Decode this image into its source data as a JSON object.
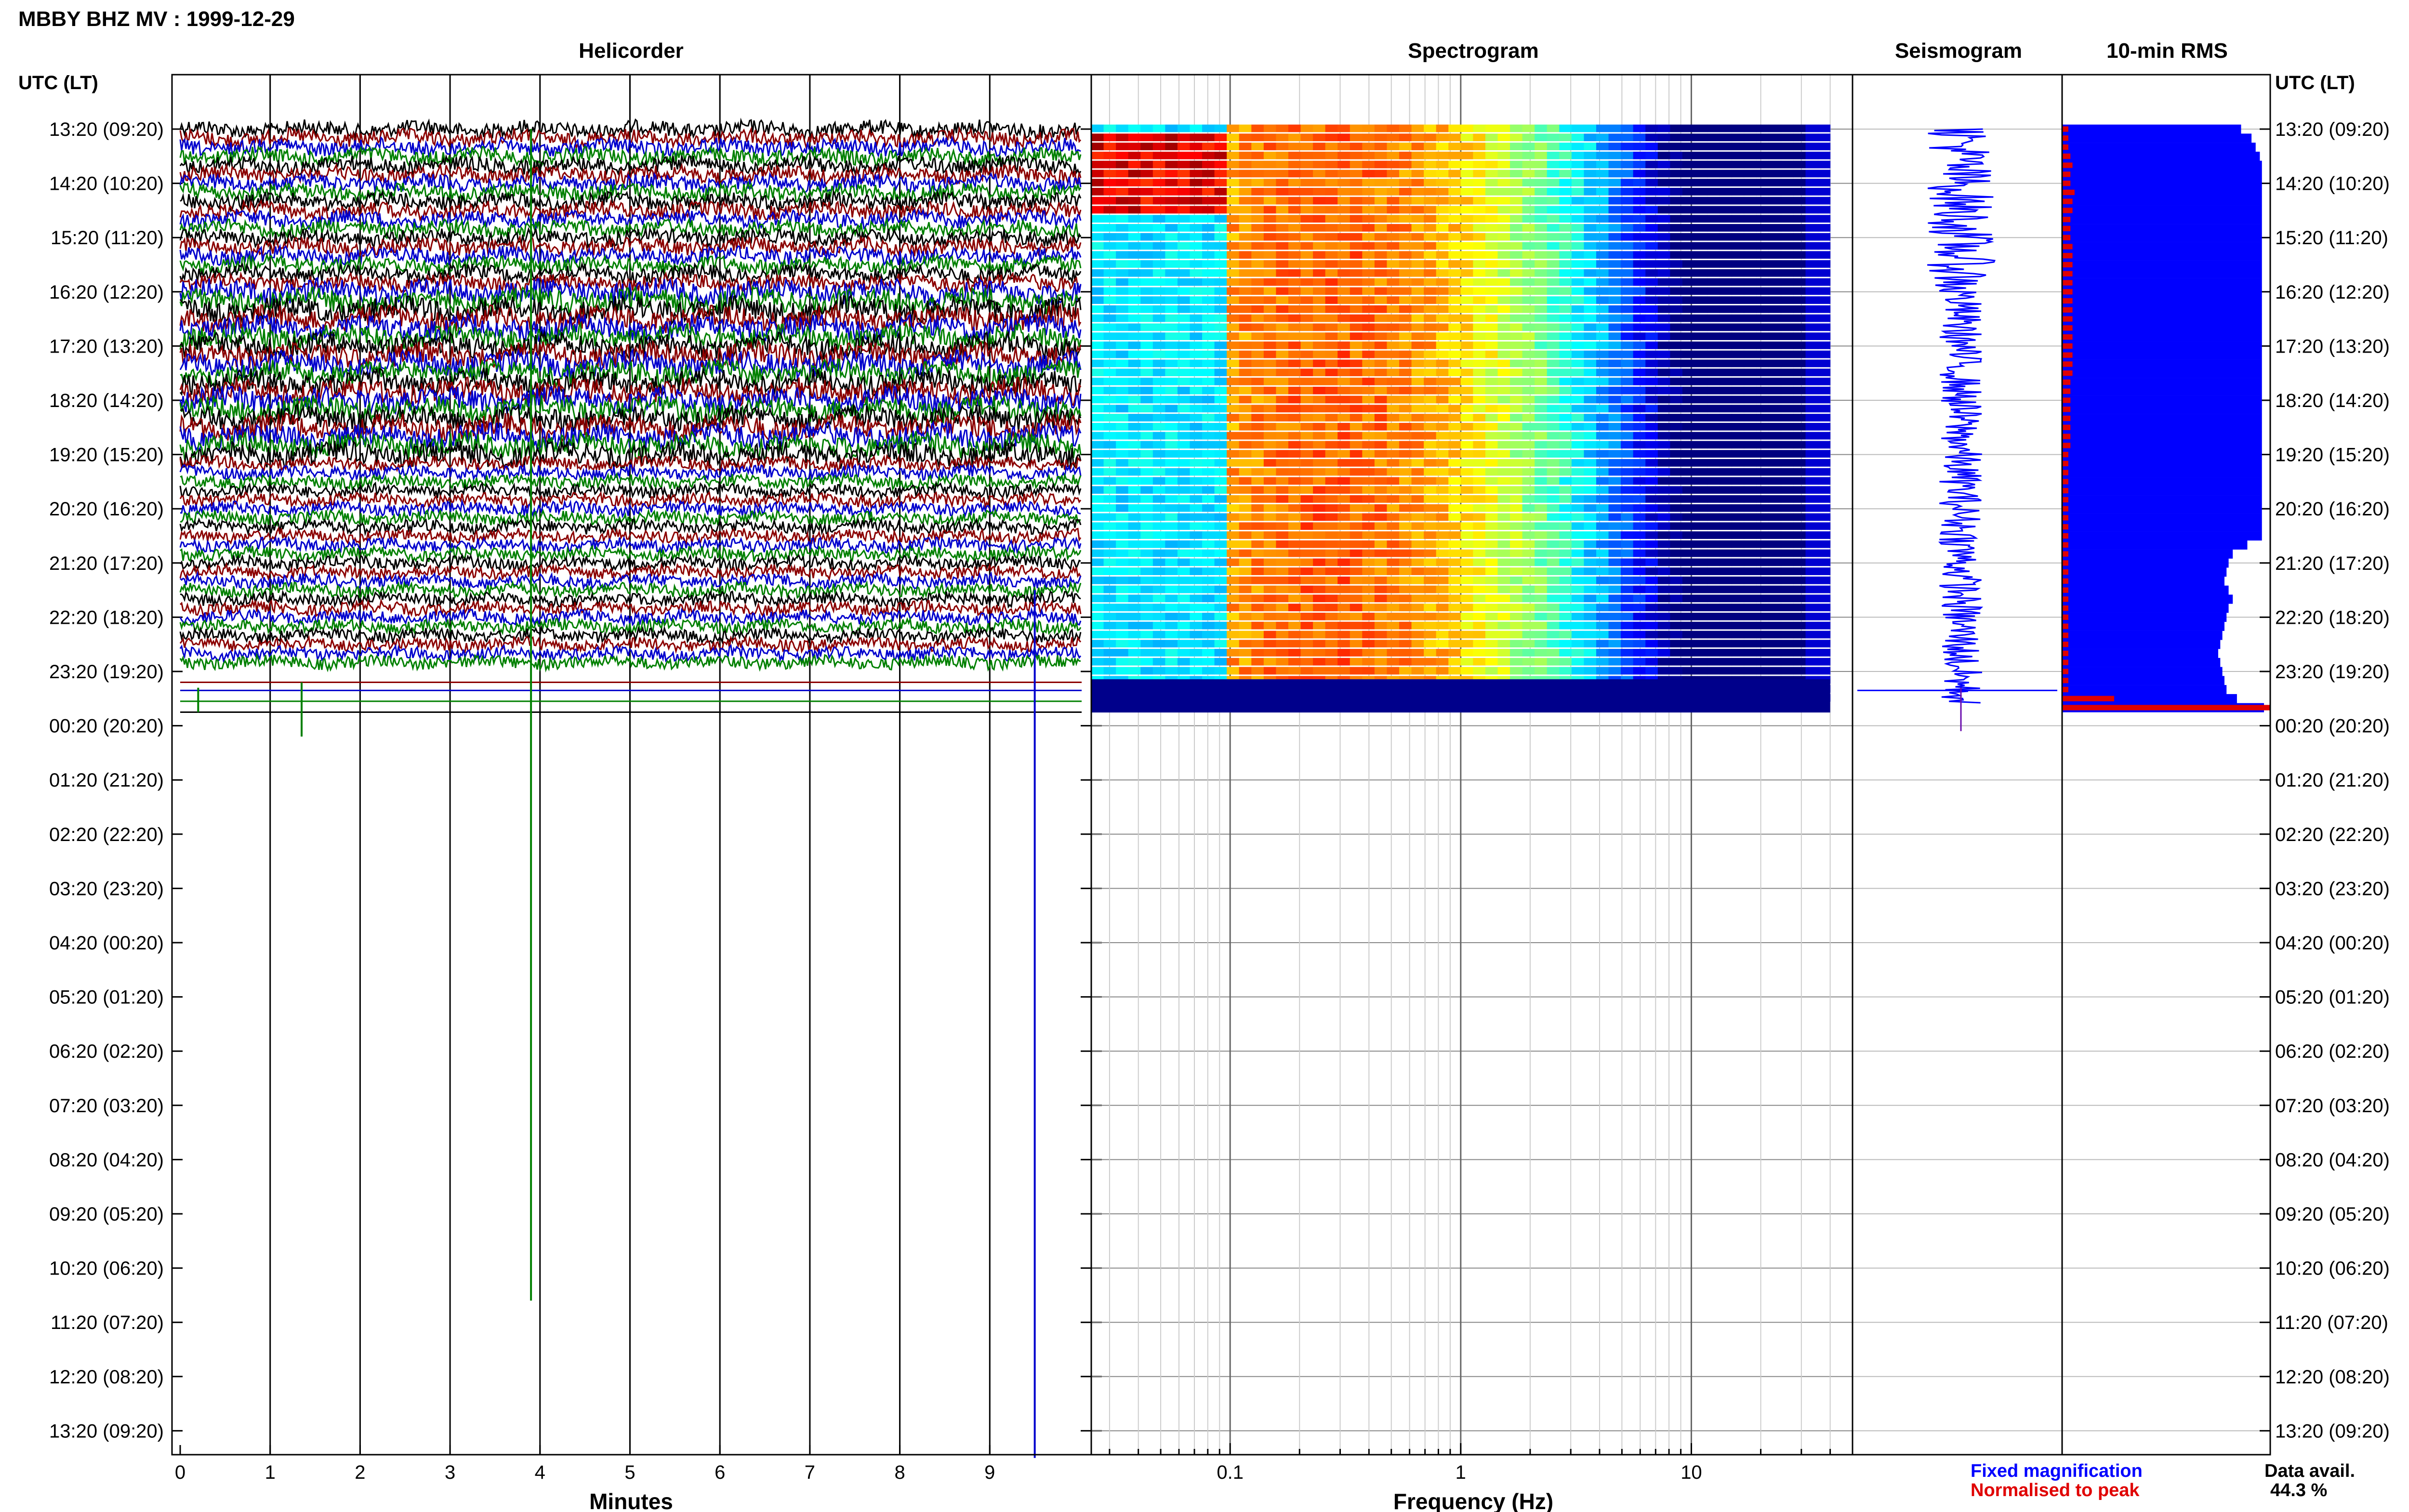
{
  "chart_data": {
    "type": "heatmap",
    "title": "MBBY BHZ MV : 1999-12-29",
    "row_axis_label": "UTC (LT)",
    "row_labels": [
      "13:20 (09:20)",
      "14:20 (10:20)",
      "15:20 (11:20)",
      "16:20 (12:20)",
      "17:20 (13:20)",
      "18:20 (14:20)",
      "19:20 (15:20)",
      "20:20 (16:20)",
      "21:20 (17:20)",
      "22:20 (18:20)",
      "23:20 (19:20)",
      "00:20 (20:20)",
      "01:20 (21:20)",
      "02:20 (22:20)",
      "03:20 (23:20)",
      "04:20 (00:20)",
      "05:20 (01:20)",
      "06:20 (02:20)",
      "07:20 (03:20)",
      "08:20 (04:20)",
      "09:20 (05:20)",
      "10:20 (06:20)",
      "11:20 (07:20)",
      "12:20 (08:20)",
      "13:20 (09:20)"
    ],
    "panels": {
      "helicorder": {
        "title": "Helicorder",
        "xlabel": "Minutes",
        "x_ticks": [
          "0",
          "1",
          "2",
          "3",
          "4",
          "5",
          "6",
          "7",
          "8",
          "9"
        ],
        "xlim": [
          0,
          10
        ],
        "trace_colors": [
          "#000000",
          "#8b0000",
          "#0000cd",
          "#008000"
        ],
        "rows_per_hour": 6,
        "data_rows": 60,
        "spikes": [
          {
            "minute": 3.9,
            "from_hour": 0,
            "to_hour": 21.6,
            "color": "#008000"
          },
          {
            "minute": 9.5,
            "from_hour": 8.5,
            "to_hour": 24.5,
            "color": "#0000cd"
          },
          {
            "minute": 1.35,
            "from_hour": 10.2,
            "to_hour": 11.2,
            "color": "#008000"
          }
        ]
      },
      "spectrogram": {
        "title": "Spectrogram",
        "xlabel": "Frequency (Hz)",
        "x_scale": "log",
        "xlim": [
          0.025,
          50
        ],
        "x_ticks": [
          "0.1",
          "1",
          "10"
        ],
        "colormap": "jet",
        "data_hours": 10.7
      },
      "seismogram": {
        "title": "Seismogram",
        "color": "#0000ff",
        "data_hours": 10.6
      },
      "rms": {
        "title": "10-min RMS",
        "fixed_color": "#0000ff",
        "normalised_color": "#e00000",
        "fixed_magnification": [
          0.86,
          0.91,
          0.93,
          0.95,
          0.96,
          0.96,
          0.96,
          0.96,
          0.96,
          0.96,
          0.96,
          0.96,
          0.96,
          0.96,
          0.96,
          0.96,
          0.96,
          0.96,
          0.96,
          0.96,
          0.96,
          0.96,
          0.96,
          0.96,
          0.96,
          0.96,
          0.96,
          0.96,
          0.96,
          0.96,
          0.96,
          0.96,
          0.96,
          0.96,
          0.96,
          0.96,
          0.96,
          0.96,
          0.96,
          0.96,
          0.96,
          0.96,
          0.96,
          0.96,
          0.96,
          0.96,
          0.89,
          0.82,
          0.8,
          0.79,
          0.78,
          0.8,
          0.82,
          0.8,
          0.79,
          0.78,
          0.77,
          0.76,
          0.75,
          0.76,
          0.77,
          0.78,
          0.79,
          0.84,
          0.97
        ],
        "normalised_to_peak": [
          0.03,
          0.03,
          0.03,
          0.04,
          0.05,
          0.04,
          0.04,
          0.06,
          0.05,
          0.05,
          0.04,
          0.04,
          0.04,
          0.05,
          0.05,
          0.05,
          0.05,
          0.05,
          0.05,
          0.05,
          0.05,
          0.05,
          0.05,
          0.05,
          0.05,
          0.05,
          0.05,
          0.05,
          0.04,
          0.04,
          0.04,
          0.04,
          0.04,
          0.04,
          0.04,
          0.04,
          0.03,
          0.03,
          0.03,
          0.03,
          0.03,
          0.03,
          0.03,
          0.03,
          0.03,
          0.03,
          0.03,
          0.03,
          0.03,
          0.03,
          0.03,
          0.03,
          0.03,
          0.03,
          0.03,
          0.03,
          0.03,
          0.03,
          0.03,
          0.03,
          0.03,
          0.03,
          0.03,
          0.25,
          1.0
        ]
      }
    },
    "legend": [
      {
        "label": "Fixed magnification",
        "color": "#0000ff"
      },
      {
        "label": "Normalised to peak",
        "color": "#e00000"
      }
    ],
    "data_availability": {
      "label": "Data avail.",
      "value": "44.3 %"
    }
  }
}
